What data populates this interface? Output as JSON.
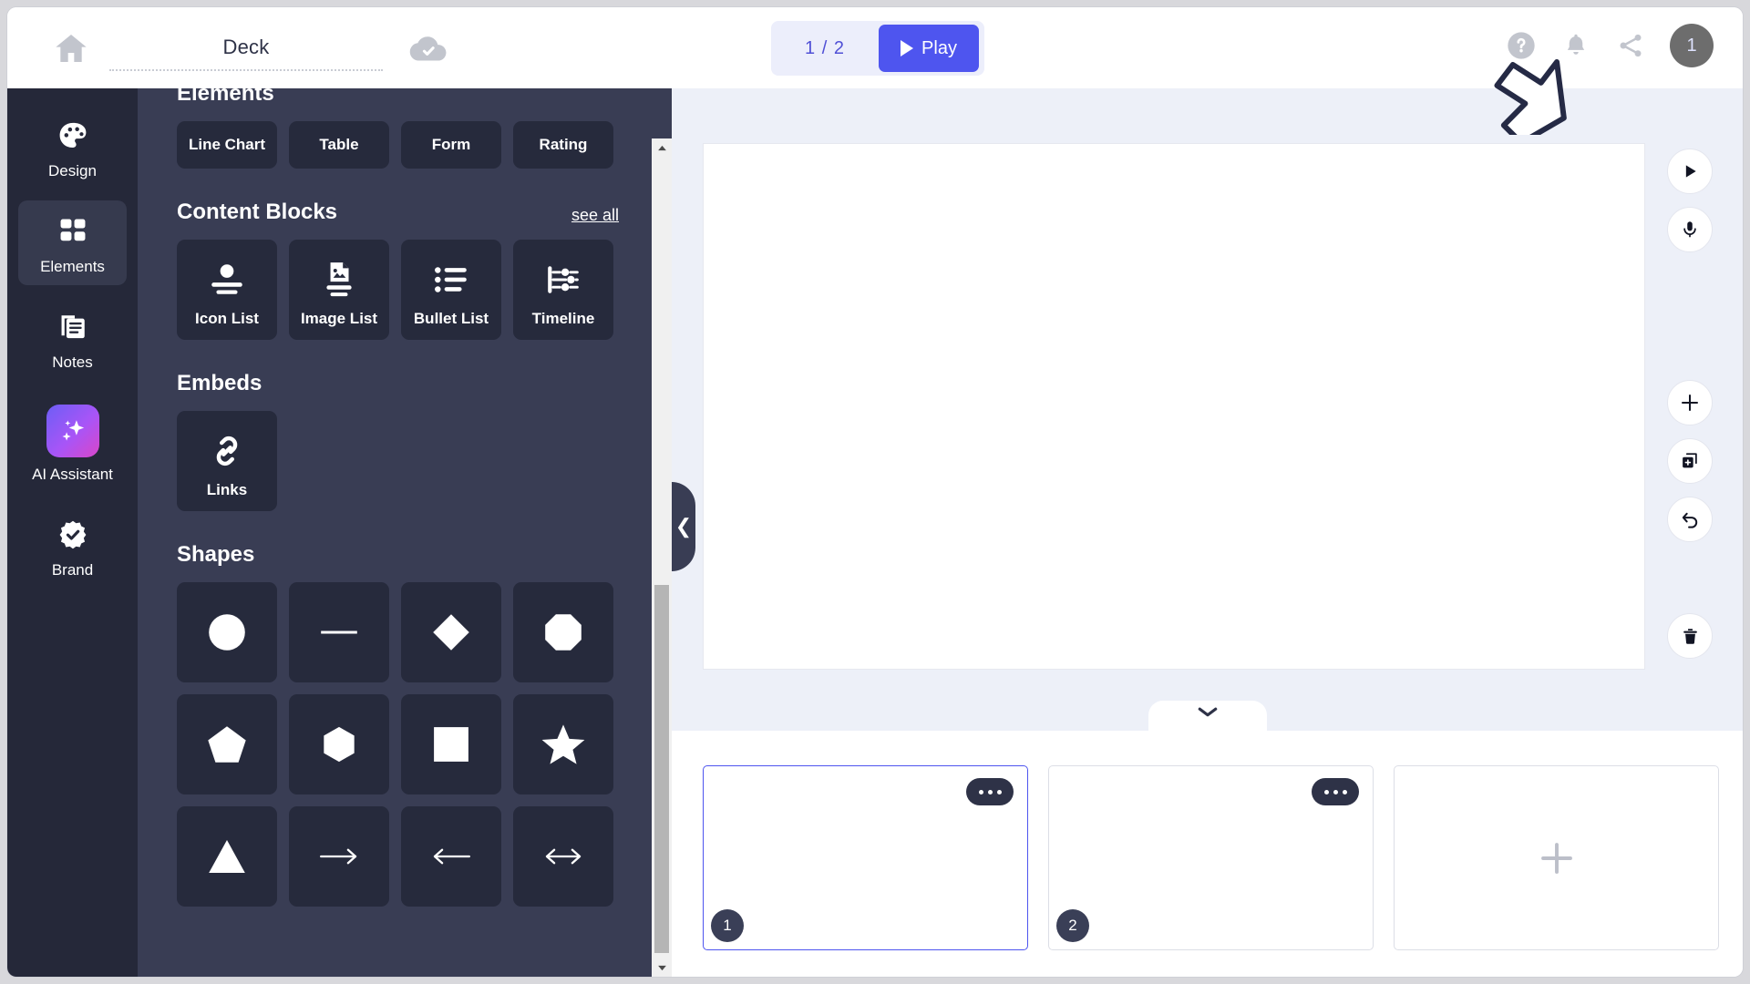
{
  "header": {
    "home_icon": "home-icon",
    "deck_title": "Deck",
    "save_status_icon": "cloud-check-icon",
    "slide_counter": "1 / 2",
    "play_label": "Play",
    "play_icon": "play-triangle-icon",
    "help_icon": "help-circle-icon",
    "notifications_icon": "bell-icon",
    "share_icon": "share-icon",
    "avatar_label": "1"
  },
  "sidebar": {
    "items": [
      {
        "label": "Design",
        "icon": "palette-icon",
        "active": false
      },
      {
        "label": "Elements",
        "icon": "grid-squares-icon",
        "active": true
      },
      {
        "label": "Notes",
        "icon": "notes-icon",
        "active": false
      },
      {
        "label": "AI Assistant",
        "icon": "sparkles-icon",
        "active": false
      },
      {
        "label": "Brand",
        "icon": "badge-check-icon",
        "active": false
      }
    ]
  },
  "panel": {
    "sections": [
      {
        "title": "Elements",
        "see_all": "",
        "cards": [
          {
            "label": "Line Chart",
            "icon": "line-chart-icon"
          },
          {
            "label": "Table",
            "icon": "table-icon"
          },
          {
            "label": "Form",
            "icon": "form-icon"
          },
          {
            "label": "Rating",
            "icon": "star-rating-icon"
          }
        ]
      },
      {
        "title": "Content Blocks",
        "see_all": "see all",
        "cards": [
          {
            "label": "Icon List",
            "icon": "icon-list-icon"
          },
          {
            "label": "Image List",
            "icon": "image-list-icon"
          },
          {
            "label": "Bullet List",
            "icon": "bullet-list-icon"
          },
          {
            "label": "Timeline",
            "icon": "timeline-icon"
          }
        ]
      },
      {
        "title": "Embeds",
        "see_all": "",
        "cards": [
          {
            "label": "Links",
            "icon": "link-icon"
          }
        ]
      }
    ],
    "shapes_title": "Shapes",
    "shapes": [
      {
        "name": "circle-shape"
      },
      {
        "name": "line-shape"
      },
      {
        "name": "diamond-shape"
      },
      {
        "name": "octagon-shape"
      },
      {
        "name": "pentagon-shape"
      },
      {
        "name": "hexagon-shape"
      },
      {
        "name": "square-shape"
      },
      {
        "name": "star-shape"
      },
      {
        "name": "triangle-shape"
      },
      {
        "name": "arrow-right-shape"
      },
      {
        "name": "arrow-left-shape"
      },
      {
        "name": "arrow-both-shape"
      }
    ],
    "collapse_icon": "chevron-left-icon"
  },
  "stage": {
    "tools": [
      {
        "name": "play-slide-button",
        "icon": "play-icon"
      },
      {
        "name": "record-audio-button",
        "icon": "microphone-icon"
      },
      {
        "name": "add-slide-button",
        "icon": "plus-icon"
      },
      {
        "name": "duplicate-slide-button",
        "icon": "duplicate-icon"
      },
      {
        "name": "undo-button",
        "icon": "undo-icon"
      },
      {
        "name": "delete-slide-button",
        "icon": "trash-icon"
      }
    ],
    "tray_toggle_icon": "chevron-down-icon"
  },
  "tray": {
    "slides": [
      {
        "number": "1",
        "selected": true,
        "menu_icon": "more-dots-icon"
      },
      {
        "number": "2",
        "selected": false,
        "menu_icon": "more-dots-icon"
      }
    ],
    "add_slide_icon": "plus-icon"
  },
  "colors": {
    "accent": "#4e55ef",
    "panel_bg": "#393d54",
    "rail_bg": "#252839",
    "card_bg": "#262a3c",
    "stage_bg": "#edf0f8"
  }
}
